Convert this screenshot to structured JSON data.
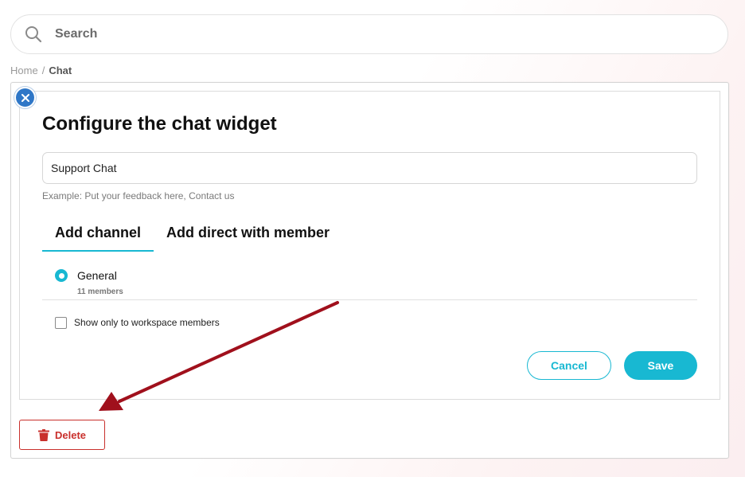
{
  "search": {
    "placeholder": "Search"
  },
  "breadcrumb": {
    "home": "Home",
    "separator": "/",
    "current": "Chat"
  },
  "dialog": {
    "title": "Configure the chat widget",
    "name_value": "Support Chat",
    "hint": "Example: Put your feedback here, Contact us",
    "tabs": [
      {
        "label": "Add channel",
        "active": true
      },
      {
        "label": "Add direct with member",
        "active": false
      }
    ],
    "channel": {
      "name": "General",
      "members": "11 members",
      "selected": true
    },
    "checkbox": {
      "label": "Show only to workspace members",
      "checked": false
    },
    "buttons": {
      "cancel": "Cancel",
      "save": "Save",
      "delete": "Delete"
    }
  },
  "colors": {
    "accent": "#18b8d2",
    "close_button": "#2f77c7",
    "danger": "#c9302c",
    "annotation_arrow": "#a0101c"
  },
  "icons": [
    "search-icon",
    "close-icon",
    "trash-icon",
    "annotation-arrow"
  ]
}
